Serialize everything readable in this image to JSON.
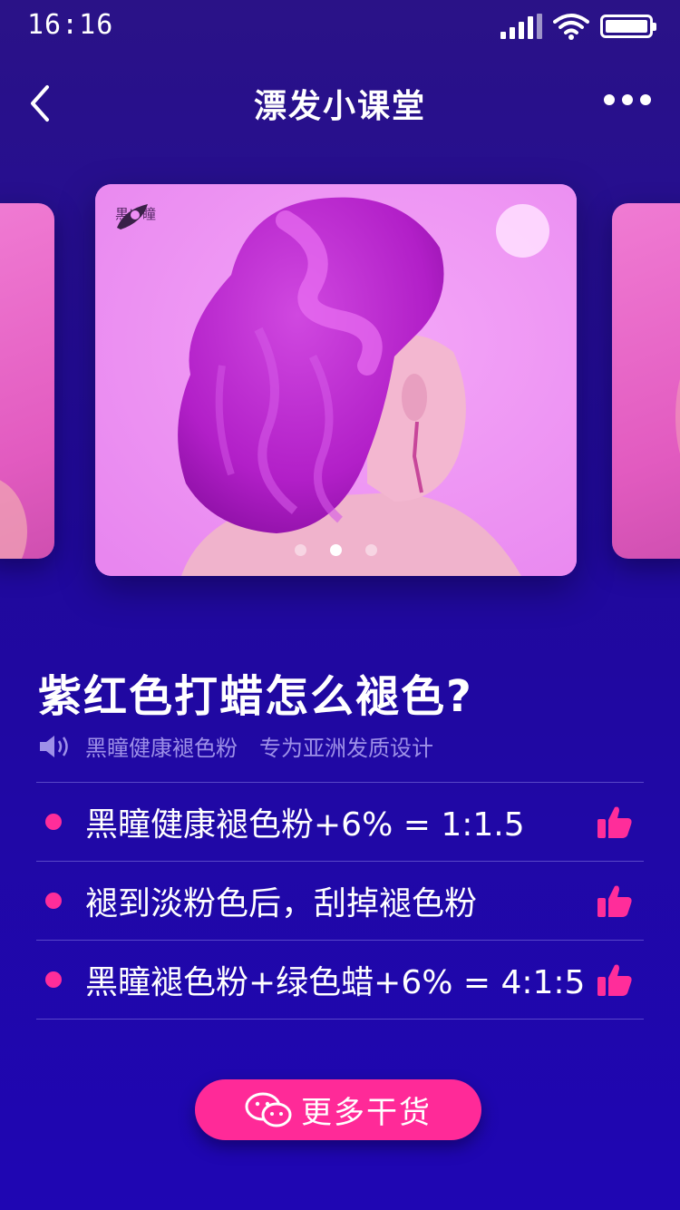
{
  "status_bar": {
    "time": "16:16"
  },
  "nav": {
    "title": "漂发小课堂"
  },
  "carousel": {
    "brand": "黒い瞳",
    "slide_count": 3,
    "active_slide": 2
  },
  "article": {
    "title": "紫红色打蜡怎么褪色?",
    "sub_brand": "黑瞳健康褪色粉",
    "sub_slogan": "专为亚洲发质设计"
  },
  "tips": [
    {
      "text": "黑瞳健康褪色粉+6% = 1:1.5"
    },
    {
      "text": "褪到淡粉色后，刮掉褪色粉"
    },
    {
      "text": "黑瞳褪色粉+绿色蜡+6% = 4:1:5"
    }
  ],
  "cta": {
    "label": "更多干货"
  },
  "colors": {
    "accent": "#ff2a98",
    "background_top": "#2a1287",
    "background_bottom": "#1f06b3"
  }
}
